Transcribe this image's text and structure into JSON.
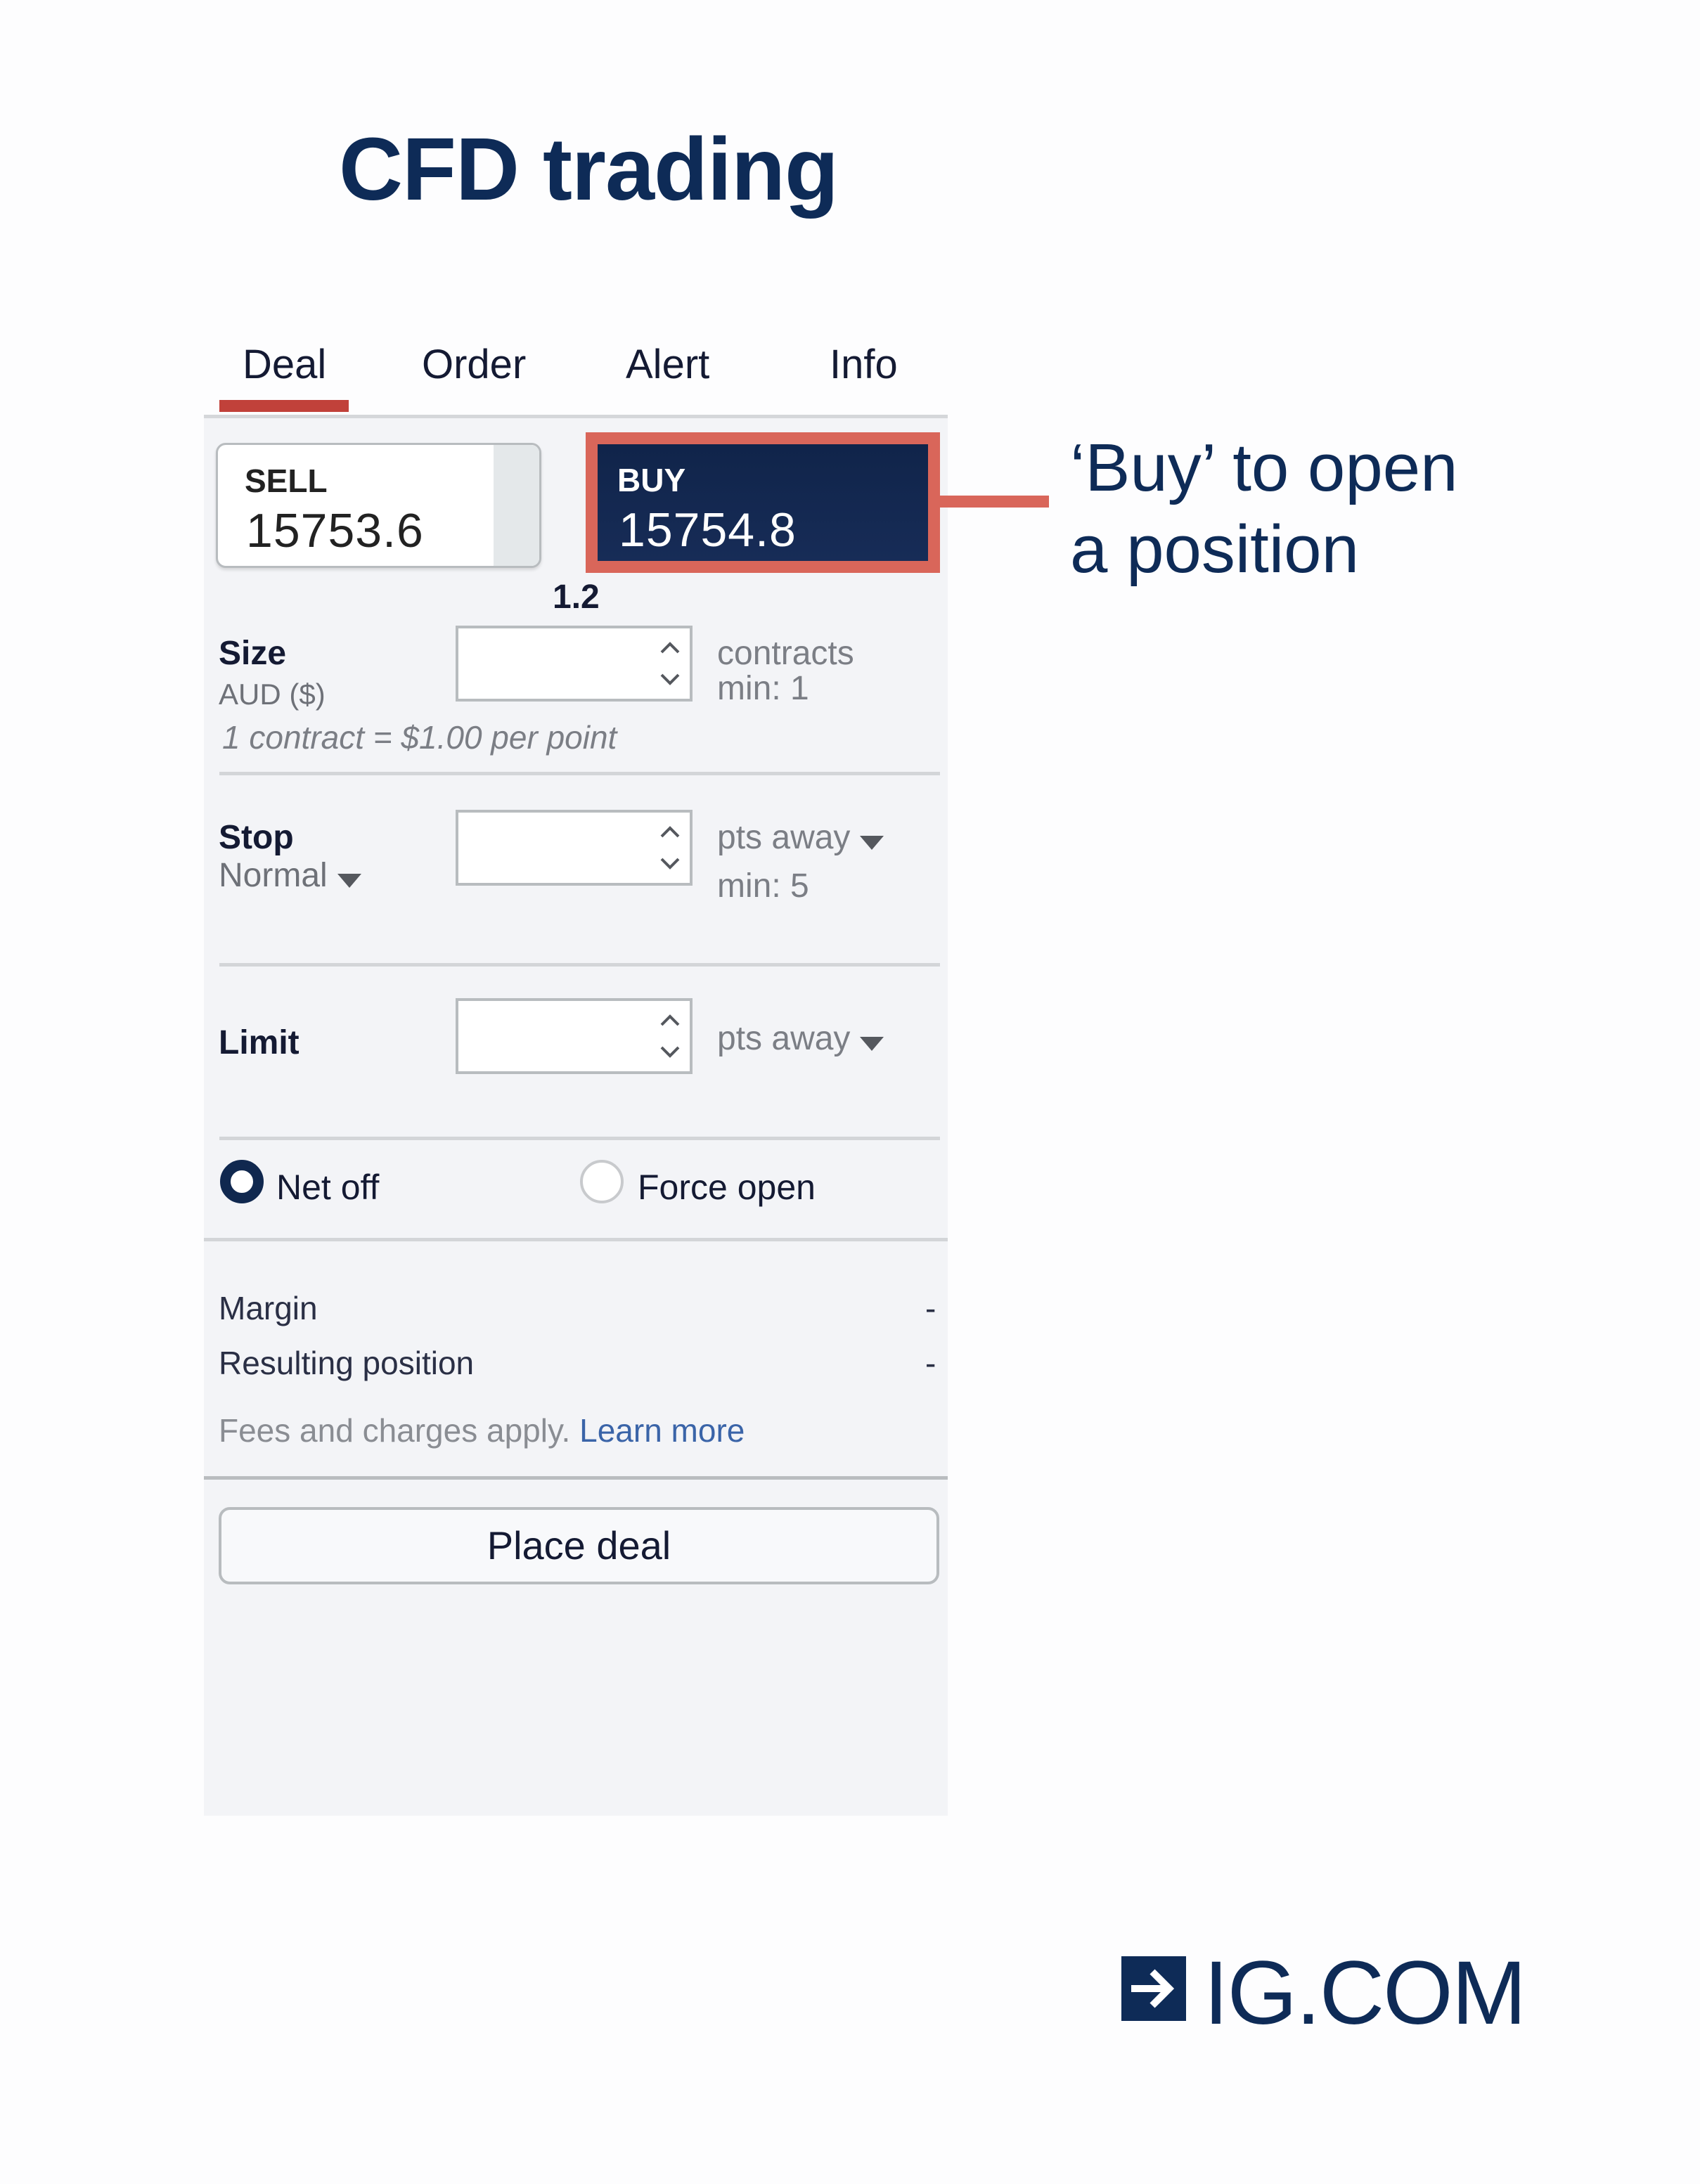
{
  "title": "CFD trading",
  "tabs": [
    {
      "label": "Deal",
      "active": true
    },
    {
      "label": "Order",
      "active": false
    },
    {
      "label": "Alert",
      "active": false
    },
    {
      "label": "Info",
      "active": false
    }
  ],
  "prices": {
    "sell_label": "SELL",
    "sell_value": "15753.6",
    "buy_label": "BUY",
    "buy_value": "15754.8",
    "spread": "1.2"
  },
  "size": {
    "label": "Size",
    "currency": "AUD ($)",
    "value": "",
    "unit": "contracts",
    "min": "min: 1",
    "note": "1 contract = $1.00 per point"
  },
  "stop": {
    "label": "Stop",
    "type": "Normal",
    "value": "",
    "unit": "pts away",
    "min": "min: 5"
  },
  "limit": {
    "label": "Limit",
    "value": "",
    "unit": "pts away"
  },
  "position_mode": {
    "options": [
      {
        "label": "Net off",
        "selected": true
      },
      {
        "label": "Force open",
        "selected": false
      }
    ]
  },
  "summary": {
    "margin_label": "Margin",
    "margin_value": "-",
    "resulting_label": "Resulting position",
    "resulting_value": "-",
    "fees_text": "Fees and charges apply. ",
    "learn_more": "Learn more"
  },
  "place_deal_label": "Place deal",
  "annotation": {
    "line1": "‘Buy’ to open",
    "line2": "a position"
  },
  "logo": {
    "text": "IG.COM",
    "icon": "arrow-right-icon"
  },
  "colors": {
    "brand_navy": "#0e2b57",
    "highlight": "#d9665a",
    "tab_active": "#c1413a",
    "link": "#3a64a8"
  }
}
